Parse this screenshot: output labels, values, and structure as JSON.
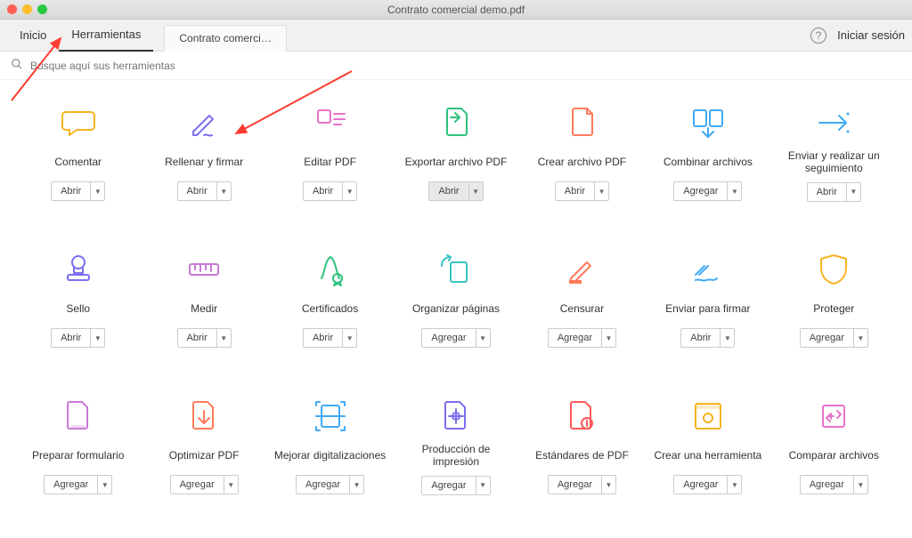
{
  "window": {
    "title": "Contrato comercial demo.pdf"
  },
  "tabs": {
    "home": "Inicio",
    "tools": "Herramientas",
    "doc": "Contrato comerci…"
  },
  "right": {
    "signin": "Iniciar sesión"
  },
  "search": {
    "placeholder": "Busque aquí sus herramientas"
  },
  "btn": {
    "open": "Abrir",
    "add": "Agregar"
  },
  "tools": [
    {
      "label": "Comentar",
      "btn": "open",
      "icon": "comment",
      "color": "#f6b323"
    },
    {
      "label": "Rellenar y firmar",
      "btn": "open",
      "icon": "fillsign",
      "color": "#7a6ff0"
    },
    {
      "label": "Editar PDF",
      "btn": "open",
      "icon": "edit",
      "color": "#e673c8"
    },
    {
      "label": "Exportar archivo PDF",
      "btn": "open",
      "icon": "export",
      "color": "#2ec27e",
      "selected": true
    },
    {
      "label": "Crear archivo PDF",
      "btn": "open",
      "icon": "create",
      "color": "#ff7b5a"
    },
    {
      "label": "Combinar archivos",
      "btn": "add",
      "icon": "combine",
      "color": "#3fa9f5"
    },
    {
      "label": "Enviar y realizar un seguimiento",
      "btn": "open",
      "icon": "send",
      "color": "#3fa9f5"
    },
    {
      "label": "Sello",
      "btn": "open",
      "icon": "stamp",
      "color": "#7a6ff0"
    },
    {
      "label": "Medir",
      "btn": "open",
      "icon": "measure",
      "color": "#c97ad6"
    },
    {
      "label": "Certificados",
      "btn": "open",
      "icon": "cert",
      "color": "#2ec27e"
    },
    {
      "label": "Organizar páginas",
      "btn": "add",
      "icon": "organize",
      "color": "#35c4c4"
    },
    {
      "label": "Censurar",
      "btn": "add",
      "icon": "redact",
      "color": "#ff7b5a"
    },
    {
      "label": "Enviar para firmar",
      "btn": "open",
      "icon": "sendsign",
      "color": "#3fa9f5"
    },
    {
      "label": "Proteger",
      "btn": "add",
      "icon": "protect",
      "color": "#f6b323"
    },
    {
      "label": "Preparar formulario",
      "btn": "add",
      "icon": "form",
      "color": "#c97ad6"
    },
    {
      "label": "Optimizar PDF",
      "btn": "add",
      "icon": "optimize",
      "color": "#ff7b5a"
    },
    {
      "label": "Mejorar digitalizaciones",
      "btn": "add",
      "icon": "scan",
      "color": "#3fa9f5"
    },
    {
      "label": "Producción de impresión",
      "btn": "add",
      "icon": "print",
      "color": "#7a6ff0"
    },
    {
      "label": "Estándares de PDF",
      "btn": "add",
      "icon": "standards",
      "color": "#ff5a5a"
    },
    {
      "label": "Crear una herramienta",
      "btn": "add",
      "icon": "createtool",
      "color": "#f6b323"
    },
    {
      "label": "Comparar archivos",
      "btn": "add",
      "icon": "compare",
      "color": "#e673c8"
    }
  ]
}
